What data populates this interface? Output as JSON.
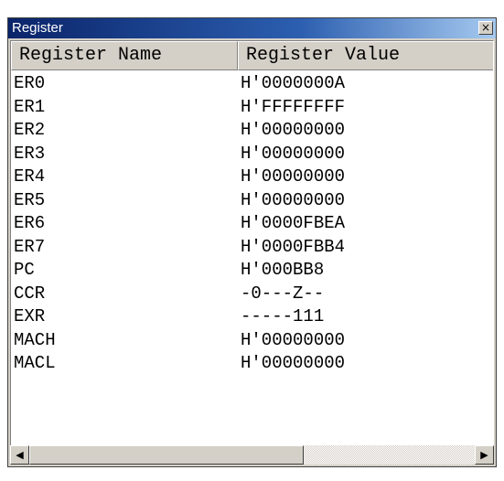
{
  "window": {
    "title": "Register",
    "close_glyph": "×"
  },
  "columns": {
    "name": "Register Name",
    "value": "Register Value"
  },
  "registers": [
    {
      "name": "ER0",
      "value": "H'0000000A"
    },
    {
      "name": "ER1",
      "value": "H'FFFFFFFF"
    },
    {
      "name": "ER2",
      "value": "H'00000000"
    },
    {
      "name": "ER3",
      "value": "H'00000000"
    },
    {
      "name": "ER4",
      "value": "H'00000000"
    },
    {
      "name": "ER5",
      "value": "H'00000000"
    },
    {
      "name": "ER6",
      "value": "H'0000FBEA"
    },
    {
      "name": "ER7",
      "value": "H'0000FBB4"
    },
    {
      "name": "PC",
      "value": "H'000BB8"
    },
    {
      "name": "CCR",
      "value": "-0---Z--"
    },
    {
      "name": "EXR",
      "value": "-----111"
    },
    {
      "name": "MACH",
      "value": "H'00000000"
    },
    {
      "name": "MACL",
      "value": "H'00000000"
    }
  ],
  "scrollbar": {
    "left_icon": "scroll-left-arrow",
    "right_icon": "scroll-right-arrow"
  }
}
